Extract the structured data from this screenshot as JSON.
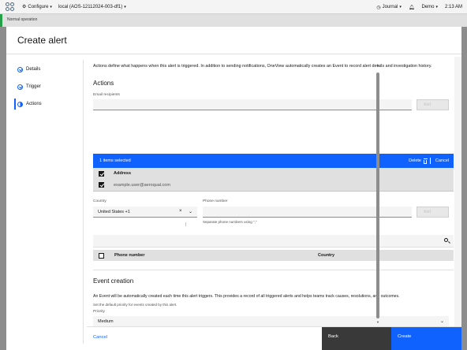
{
  "topbar": {
    "configure_label": "Configure",
    "context_label": "local (AOS-12112024-003-df1)",
    "journal_label": "Journal",
    "user_label": "Demo",
    "time": "2:13 AM"
  },
  "status_strip": {
    "label": "Normal operation",
    "accent_color": "#24a148"
  },
  "modal": {
    "title": "Create alert",
    "steps": [
      {
        "label": "Details",
        "state": "complete"
      },
      {
        "label": "Trigger",
        "state": "complete"
      },
      {
        "label": "Actions",
        "state": "current"
      }
    ],
    "intro": "Actions define what happens when this alert is triggered. In addition to sending notifications, OneView automatically creates an Event to record alert details and investigation history.",
    "actions": {
      "title": "Actions",
      "email_label": "Email recipients",
      "email_value": "",
      "email_add_label": "Add",
      "batch": {
        "selected_text": "1 items selected",
        "delete_label": "Delete",
        "cancel_label": "Cancel"
      },
      "email_table": {
        "header": "Address",
        "rows": [
          {
            "address": "example.user@aeroqual.com",
            "checked": true
          }
        ]
      },
      "country_label": "Country",
      "country_value": "United States +1",
      "phone_label": "Phone number",
      "phone_value": "",
      "phone_add_label": "Add",
      "phone_helper": "Separate phone numbers using \",\"",
      "phone_table": {
        "headers": [
          "Phone number",
          "Country"
        ]
      }
    },
    "event": {
      "title": "Event creation",
      "description": "An Event will be automatically created each time this alert triggers. This provides a record of all triggered alerts and helps teams track causes, resolutions, and outcomes.",
      "priority_label": "Priority",
      "priority_value": "Medium",
      "priority_helper": "Set the default priority for events created by this alert."
    },
    "footer": {
      "cancel_label": "Cancel",
      "back_label": "Back",
      "create_label": "Create"
    }
  },
  "colors": {
    "primary": "#0f62fe",
    "dark_button": "#393939",
    "overlay": "#8d8d8d"
  }
}
